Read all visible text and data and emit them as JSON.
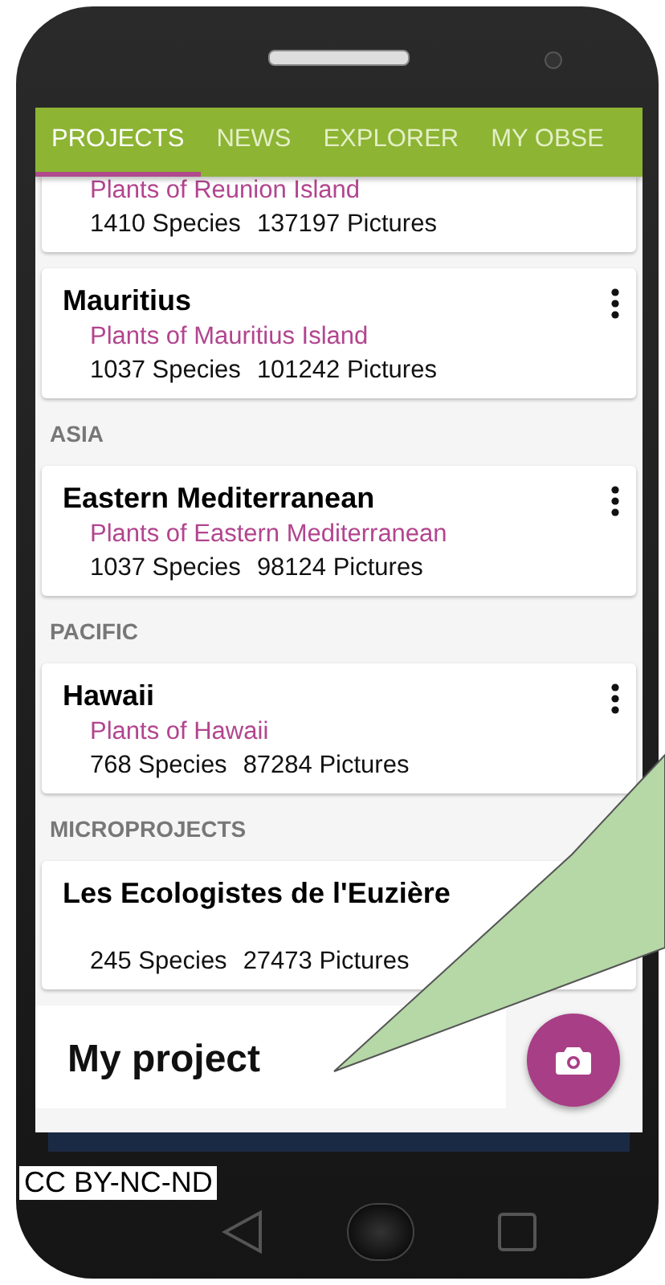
{
  "tabs": [
    {
      "label": "PROJECTS",
      "selected": true
    },
    {
      "label": "NEWS",
      "selected": false
    },
    {
      "label": "EXPLORER",
      "selected": false
    },
    {
      "label": "MY OBSE",
      "selected": false
    }
  ],
  "sections": [
    {
      "projects": [
        {
          "subtitle": "Plants of Reunion Island",
          "species": "1410 Species",
          "pictures": "137197 Pictures",
          "menu": false
        },
        {
          "title": "Mauritius",
          "subtitle": "Plants of Mauritius Island",
          "species": "1037 Species",
          "pictures": "101242 Pictures",
          "menu": true
        }
      ]
    },
    {
      "heading": "ASIA",
      "projects": [
        {
          "title": "Eastern Mediterranean",
          "subtitle": "Plants of Eastern Mediterranean",
          "species": "1037 Species",
          "pictures": "98124 Pictures",
          "menu": true
        }
      ]
    },
    {
      "heading": "PACIFIC",
      "projects": [
        {
          "title": "Hawaii",
          "subtitle": "Plants of Hawaii",
          "species": "768 Species",
          "pictures": "87284 Pictures",
          "menu": true
        }
      ]
    },
    {
      "heading": "MICROPROJECTS",
      "projects": [
        {
          "title": "Les Ecologistes de l'Euzière",
          "species": "245 Species",
          "pictures": "27473 Pictures"
        }
      ]
    }
  ],
  "callout": {
    "text": "My project"
  },
  "license": "CC BY-NC-ND"
}
